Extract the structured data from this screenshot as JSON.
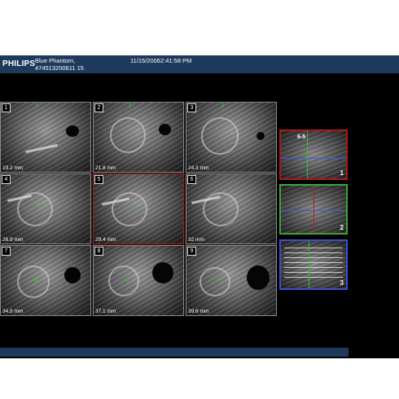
{
  "header": {
    "logo": "PHILIPS",
    "patient_name": "Blue Phantom,",
    "patient_id": "474513200611 15",
    "datetime": "11/15/20062:41:58 PM"
  },
  "tiles": [
    {
      "num": "1",
      "depth": "19.2 mm"
    },
    {
      "num": "2",
      "depth": "21.8 mm"
    },
    {
      "num": "3",
      "depth": "24.3 mm"
    },
    {
      "num": "4",
      "depth": "26.9 mm"
    },
    {
      "num": "5",
      "depth": "29.4 mm"
    },
    {
      "num": "6",
      "depth": "32 mm"
    },
    {
      "num": "7",
      "depth": "34.5 mm"
    },
    {
      "num": "8",
      "depth": "37.1 mm"
    },
    {
      "num": "9",
      "depth": "39.6 mm"
    }
  ],
  "side_views": [
    {
      "num": "1",
      "label": "6-5",
      "border_color": "#b01818"
    },
    {
      "num": "2",
      "label": "",
      "border_color": "#3aa63a"
    },
    {
      "num": "3",
      "label": "",
      "border_color": "#3a4fd0"
    }
  ],
  "colors": {
    "header_bar": "#1d3a5c",
    "selected_tile": "#b01818",
    "crosshair_green": "#2ec42e",
    "crosshair_blue": "#3a5be0"
  }
}
